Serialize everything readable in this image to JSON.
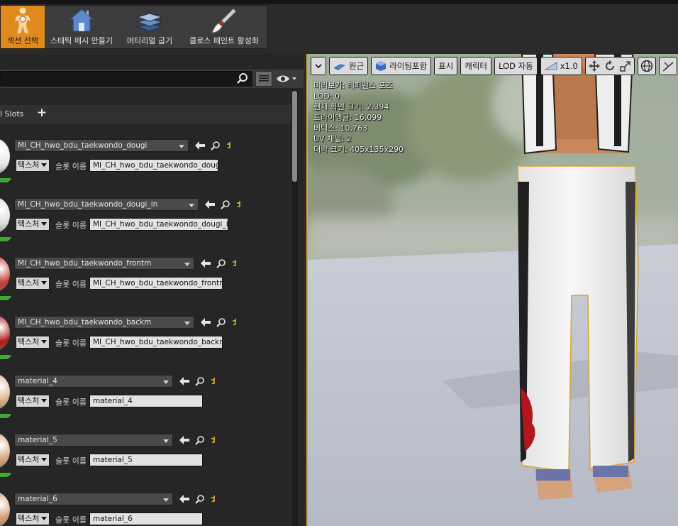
{
  "toolbar": {
    "buttons": [
      {
        "label": "섹션 선택",
        "icon": "section-select-figure-icon",
        "active": true
      },
      {
        "label": "스태틱 메시 만들기",
        "icon": "house-mesh-icon"
      },
      {
        "label": "머티리얼 굽기",
        "icon": "material-layers-icon"
      },
      {
        "label": "클로스 페인트 활성화",
        "icon": "cloth-paint-brush-icon"
      }
    ]
  },
  "left_panel": {
    "search": {
      "placeholder": ""
    },
    "slots_title": "l Slots",
    "materials": [
      {
        "material": "MI_CH_hwo_bdu_taekwondo_dougi",
        "texture_label": "텍스처",
        "slot_label": "슬롯 이름",
        "slot_name": "MI_CH_hwo_bdu_taekwondo_dougi",
        "thumb": "#e6e6e6"
      },
      {
        "material": "MI_CH_hwo_bdu_taekwondo_dougi_in",
        "texture_label": "텍스처",
        "slot_label": "슬롯 이름",
        "slot_name": "MI_CH_hwo_bdu_taekwondo_dougi_in",
        "thumb": "#dcdcdc"
      },
      {
        "material": "MI_CH_hwo_bdu_taekwondo_frontm",
        "texture_label": "텍스처",
        "slot_label": "슬롯 이름",
        "slot_name": "MI_CH_hwo_bdu_taekwondo_frontm",
        "thumb": "#c83a3a"
      },
      {
        "material": "MI_CH_hwo_bdu_taekwondo_backm",
        "texture_label": "텍스처",
        "slot_label": "슬롯 이름",
        "slot_name": "MI_CH_hwo_bdu_taekwondo_backm",
        "thumb": "#b01c1c"
      },
      {
        "material": "material_4",
        "texture_label": "텍스처",
        "slot_label": "슬롯 이름",
        "slot_name": "material_4",
        "thumb": "#d9b08a"
      },
      {
        "material": "material_5",
        "texture_label": "텍스처",
        "slot_label": "슬롯 이름",
        "slot_name": "material_5",
        "thumb": "#d4a47c"
      },
      {
        "material": "material_6",
        "texture_label": "텍스처",
        "slot_label": "슬롯 이름",
        "slot_name": "material_6",
        "thumb": "#cf9e74"
      }
    ]
  },
  "viewport": {
    "toolbar": {
      "perspective": "원근",
      "lighting": "라이팅포함",
      "show": "표시",
      "character": "캐릭터",
      "lod": "LOD 자동",
      "speed": "x1.0"
    },
    "info": [
      "미리보기: 레퍼런스 포즈",
      "LOD: 0",
      "현재 화면 크기: 2.394",
      "트라이앵글: 16,099",
      "버텍스: 10,763",
      "UV 채널: 2",
      "대략 크기: 405x135x290"
    ]
  },
  "colors": {
    "accent": "#e08a1e",
    "selection_outline": "#d7a632",
    "slot_green": "#3faa33"
  }
}
